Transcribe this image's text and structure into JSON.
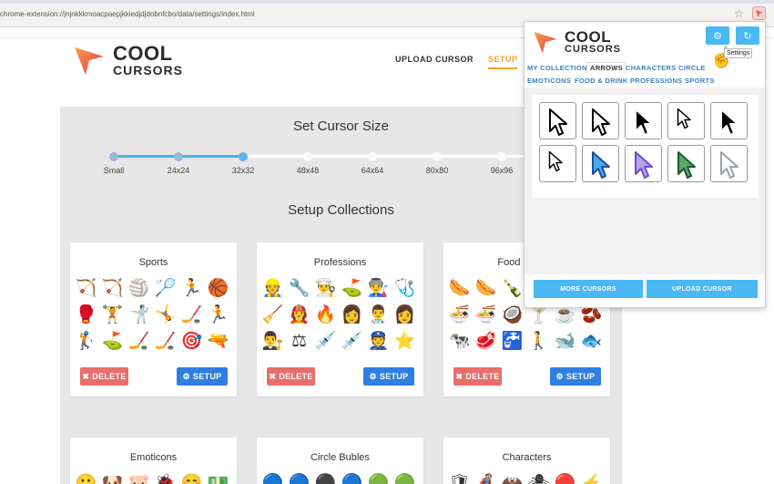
{
  "browser": {
    "url": "chrome-extension://jnjnkkkmoacpaepjkkiedjdjdobnfcbo/data/settings/index.html",
    "star_icon": "star-icon",
    "extension_icon": "cool-cursors-extension-icon"
  },
  "brand": {
    "line1": "COOL",
    "line2": "CURSORS",
    "accent": "#f0504a"
  },
  "nav": {
    "upload": "UPLOAD CURSOR",
    "setup": "SETUP"
  },
  "cursor_size": {
    "title": "Set Cursor Size",
    "options": [
      "Small",
      "24x24",
      "32x32",
      "48x48",
      "64x64",
      "80x80",
      "96x96"
    ],
    "selected_index": 2
  },
  "collections": {
    "title": "Setup Collections",
    "delete_label": "DELETE",
    "setup_label": "SETUP",
    "cards": [
      {
        "title": "Sports",
        "icons": [
          "🏹",
          "🏹",
          "🏐",
          "🏸",
          "🏃",
          "🏀",
          "🥊",
          "🏋",
          "🤺",
          "🤸",
          "🏒",
          "🏃",
          "🏌",
          "⛳",
          "🏒",
          "🏒",
          "🎯",
          "🔫"
        ]
      },
      {
        "title": "Professions",
        "icons": [
          "👷",
          "🔧",
          "👨‍🍳",
          "⛳",
          "👨‍🏭",
          "🩺",
          "🧹",
          "👩‍🚒",
          "🔥",
          "👩",
          "👨‍⚕️",
          "👩",
          "👨‍⚖️",
          "⚖",
          "💉",
          "💉",
          "👮",
          "⭐"
        ]
      },
      {
        "title": "Food & Drink",
        "icons": [
          "🌭",
          "🌭",
          "🍾",
          "🍽",
          "🍽",
          "🍷",
          "🍜",
          "🍜",
          "🥥",
          "🍸",
          "☕",
          "🫘",
          "🐄",
          "🥩",
          "🚰",
          "🚶",
          "🐋",
          "🐟"
        ]
      },
      {
        "title": "Emoticons",
        "icons": [
          "😀",
          "🐶",
          "🐷",
          "🐞",
          "😊",
          "💵"
        ]
      },
      {
        "title": "Circle Bubles",
        "icons": [
          "🔵",
          "🔵",
          "⚫",
          "🔵",
          "🟢",
          "🟢"
        ]
      },
      {
        "title": "Characters",
        "icons": [
          "🛡",
          "🦸",
          "🦇",
          "🕷",
          "🔴",
          "⚡"
        ]
      }
    ]
  },
  "popup": {
    "tooltip": "Settings",
    "tabs": [
      "MY COLLECTION",
      "ARROWS",
      "CHARACTERS",
      "CIRCLE",
      "EMOTICONS",
      "FOOD & DRINK",
      "PROFESSIONS",
      "SPORTS"
    ],
    "active_tab": "ARROWS",
    "more_label": "MORE CURSORS",
    "upload_label": "UPLOAD CURSOR",
    "cursors": [
      {
        "name": "arrow-bold-white",
        "fill": "#ffffff",
        "stroke": "#000000"
      },
      {
        "name": "arrow-white",
        "fill": "#ffffff",
        "stroke": "#000000"
      },
      {
        "name": "arrow-black",
        "fill": "#000000",
        "stroke": "#ffffff"
      },
      {
        "name": "arrow-white-small",
        "fill": "#ffffff",
        "stroke": "#000000"
      },
      {
        "name": "arrow-black-outline",
        "fill": "#000000",
        "stroke": "#ffffff"
      },
      {
        "name": "arrow-white-thin",
        "fill": "#ffffff",
        "stroke": "#000000"
      },
      {
        "name": "arrow-blue-sparkle",
        "fill": "#4aa8e8",
        "stroke": "#1b4f9c"
      },
      {
        "name": "arrow-purple-sparkle",
        "fill": "#b9a0f0",
        "stroke": "#6b4fc9"
      },
      {
        "name": "arrow-green",
        "fill": "#5aa86a",
        "stroke": "#1f5a2c"
      },
      {
        "name": "arrow-light-gray",
        "fill": "#ffffff",
        "stroke": "#9aa0a6"
      }
    ]
  }
}
